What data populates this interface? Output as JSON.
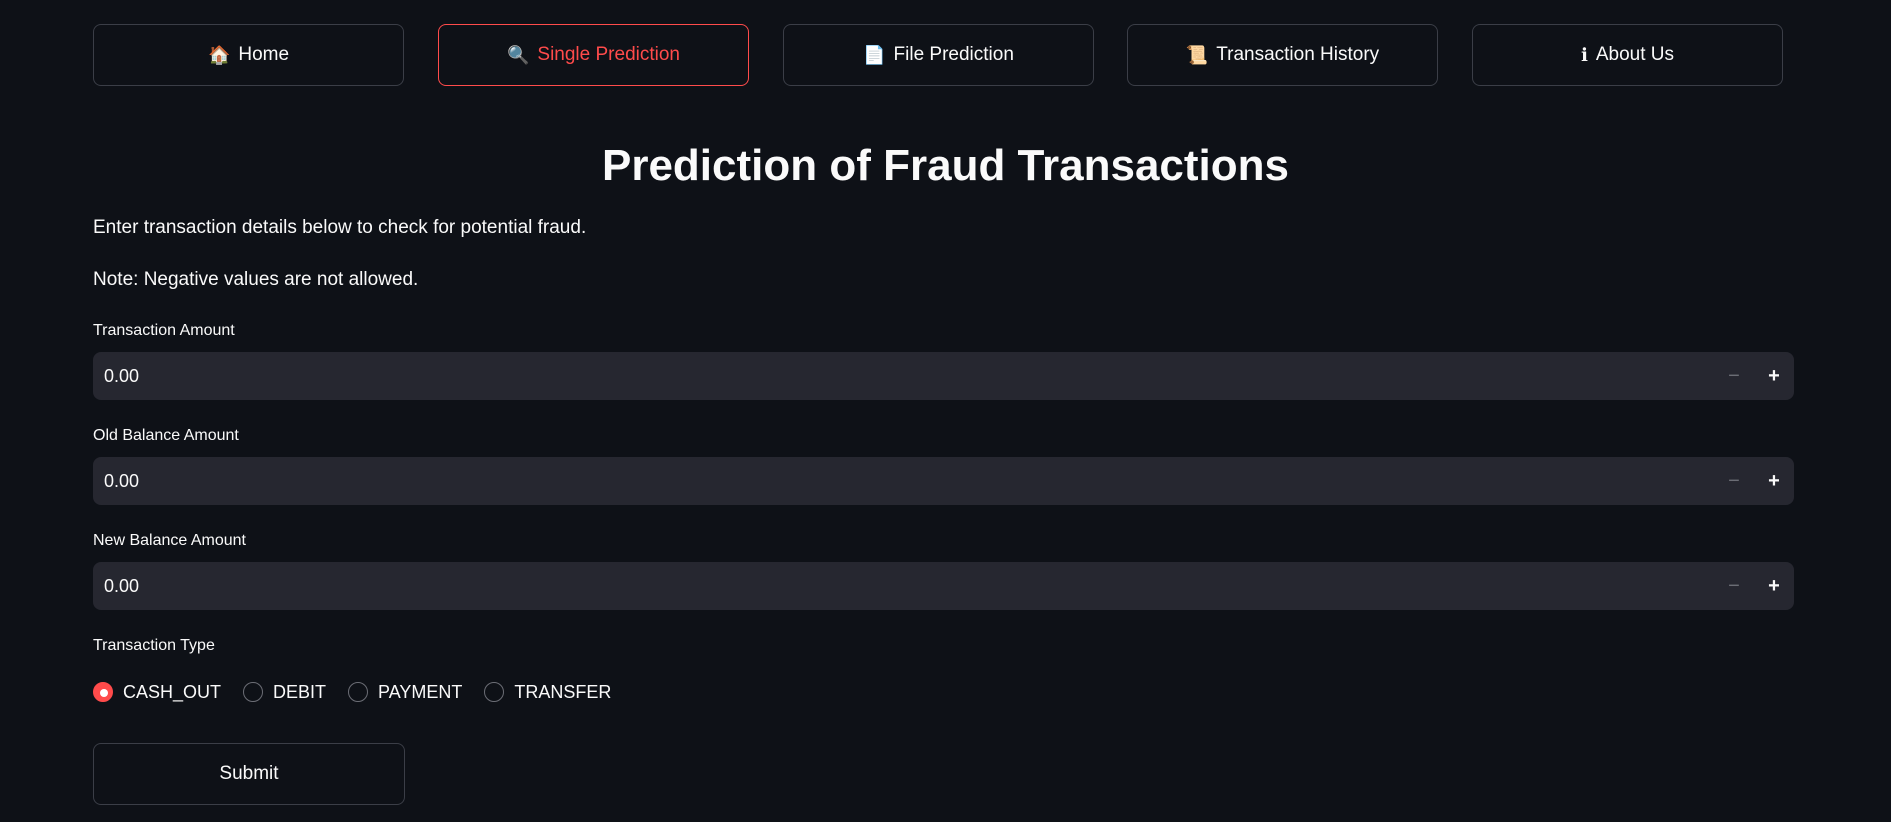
{
  "nav": {
    "home": {
      "icon": "🏠",
      "label": "Home"
    },
    "single_prediction": {
      "icon": "🔍",
      "label": "Single Prediction"
    },
    "file_prediction": {
      "icon": "📄",
      "label": "File Prediction"
    },
    "transaction_history": {
      "icon": "📜",
      "label": "Transaction History"
    },
    "about_us": {
      "icon": "ℹ",
      "label": "About Us"
    }
  },
  "active_tab": "Single Prediction",
  "accent_color": "#ff4b4b",
  "title": "Prediction of Fraud Transactions",
  "intro_text": "Enter transaction details below to check for potential fraud.",
  "note_text": "Note: Negative values are not allowed.",
  "fields": {
    "transaction_amount": {
      "label": "Transaction Amount",
      "value": "0.00"
    },
    "old_balance": {
      "label": "Old Balance Amount",
      "value": "0.00"
    },
    "new_balance": {
      "label": "New Balance Amount",
      "value": "0.00"
    }
  },
  "stepper": {
    "minus": "−",
    "plus": "+"
  },
  "transaction_type": {
    "label": "Transaction Type",
    "options": [
      "CASH_OUT",
      "DEBIT",
      "PAYMENT",
      "TRANSFER"
    ],
    "selected": "CASH_OUT"
  },
  "submit_label": "Submit"
}
